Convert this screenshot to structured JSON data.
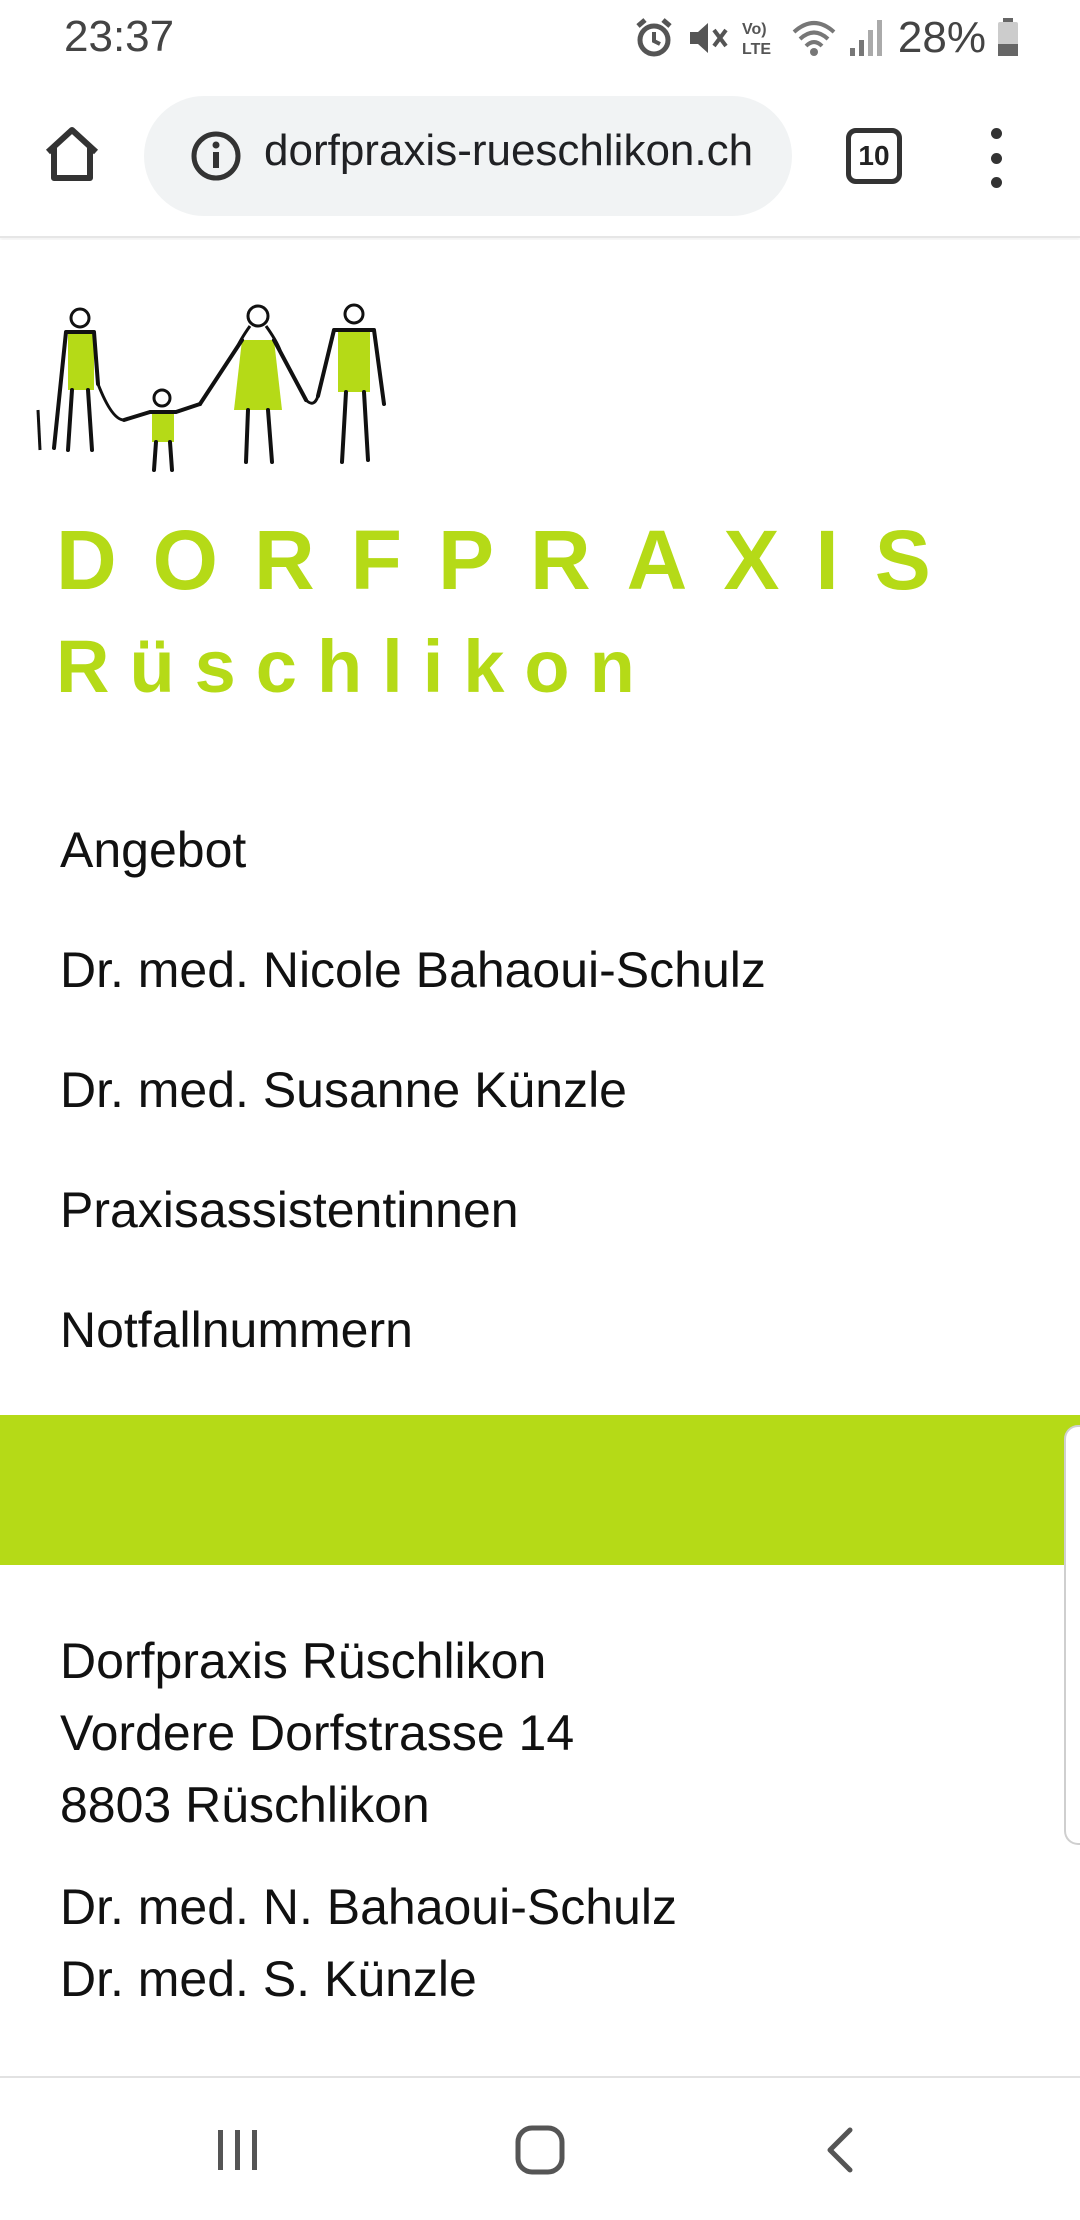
{
  "status_bar": {
    "time": "23:37",
    "battery": "28%",
    "icons": [
      "alarm-icon",
      "mute-icon",
      "volte-icon",
      "wifi-icon",
      "signal-icon",
      "battery-icon"
    ]
  },
  "browser": {
    "url": "dorfpraxis-rueschlikon.ch",
    "tab_count": "10",
    "icons": [
      "home-icon",
      "info-icon",
      "tabs-icon",
      "more-vert-icon"
    ]
  },
  "brand": {
    "title": "DORFPRAXIS",
    "subtitle": "Rüschlikon",
    "accent_color": "#b5da17"
  },
  "nav": {
    "items": [
      "Angebot",
      "Dr. med. Nicole Bahaoui-Schulz",
      "Dr. med. Susanne Künzle",
      "Praxisassistentinnen",
      "Notfallnummern"
    ]
  },
  "footer": {
    "address": [
      "Dorfpraxis Rüschlikon",
      "Vordere Dorfstrasse 14",
      "8803 Rüschlikon"
    ],
    "doctors": [
      "Dr. med. N. Bahaoui-Schulz",
      "Dr. med. S. Künzle"
    ]
  },
  "system_nav": [
    "recents-icon",
    "home-circle-icon",
    "back-icon"
  ]
}
